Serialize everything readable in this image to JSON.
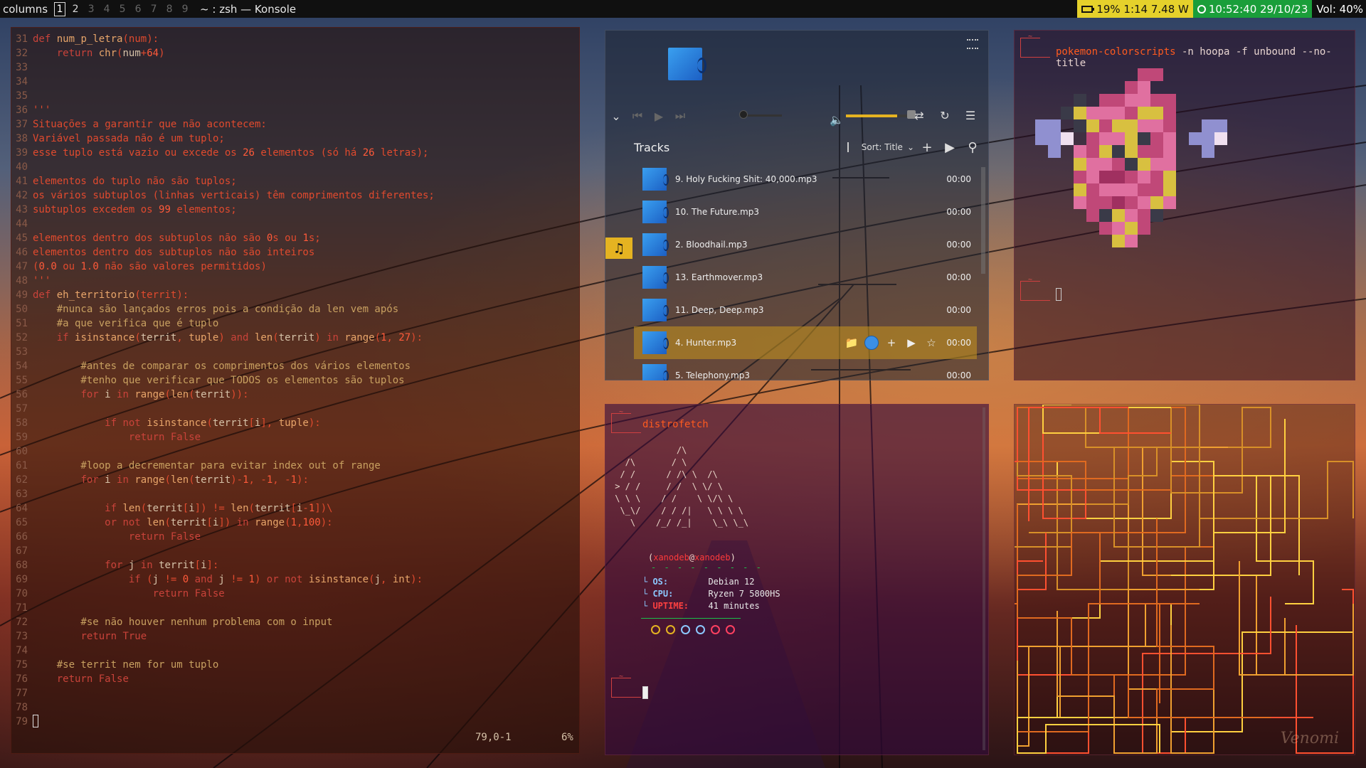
{
  "topbar": {
    "layout": "columns",
    "workspaces": [
      "1",
      "2",
      "3",
      "4",
      "5",
      "6",
      "7",
      "8",
      "9"
    ],
    "active_workspace": "1",
    "window_title": "~ : zsh — Konsole",
    "battery": "19% 1:14 7.48 W",
    "clock": "10:52:40 29/10/23",
    "volume": "Vol: 40%"
  },
  "editor": {
    "lines": [
      {
        "n": "31",
        "code": "def num_p_letra(num):"
      },
      {
        "n": "32",
        "code": "    return chr(num+64)"
      },
      {
        "n": "33",
        "code": ""
      },
      {
        "n": "34",
        "code": ""
      },
      {
        "n": "35",
        "code": ""
      },
      {
        "n": "36",
        "code": "'''"
      },
      {
        "n": "37",
        "code": "Situações a garantir que não acontecem:"
      },
      {
        "n": "38",
        "code": "Variável passada não é um tuplo;"
      },
      {
        "n": "39",
        "code": "esse tuplo está vazio ou excede os 26 elementos (só há 26 letras);"
      },
      {
        "n": "40",
        "code": ""
      },
      {
        "n": "41",
        "code": "elementos do tuplo não são tuplos;"
      },
      {
        "n": "42",
        "code": "os vários subtuplos (linhas verticais) têm comprimentos diferentes;"
      },
      {
        "n": "43",
        "code": "subtuplos excedem os 99 elementos;"
      },
      {
        "n": "44",
        "code": ""
      },
      {
        "n": "45",
        "code": "elementos dentro dos subtuplos não são 0s ou 1s;"
      },
      {
        "n": "46",
        "code": "elementos dentro dos subtuplos não são inteiros"
      },
      {
        "n": "47",
        "code": "(0.0 ou 1.0 não são valores permitidos)"
      },
      {
        "n": "48",
        "code": "'''"
      },
      {
        "n": "49",
        "code": "def eh_territorio(territ):"
      },
      {
        "n": "50",
        "code": "    #nunca são lançados erros pois a condição da len vem após"
      },
      {
        "n": "51",
        "code": "    #a que verifica que é tuplo"
      },
      {
        "n": "52",
        "code": "    if isinstance(territ, tuple) and len(territ) in range(1, 27):"
      },
      {
        "n": "53",
        "code": ""
      },
      {
        "n": "54",
        "code": "        #antes de comparar os comprimentos dos vários elementos"
      },
      {
        "n": "55",
        "code": "        #tenho que verificar que TODOS os elementos são tuplos"
      },
      {
        "n": "56",
        "code": "        for i in range(len(territ)):"
      },
      {
        "n": "57",
        "code": ""
      },
      {
        "n": "58",
        "code": "            if not isinstance(territ[i], tuple):"
      },
      {
        "n": "59",
        "code": "                return False"
      },
      {
        "n": "60",
        "code": ""
      },
      {
        "n": "61",
        "code": "        #loop a decrementar para evitar index out of range"
      },
      {
        "n": "62",
        "code": "        for i in range(len(territ)-1, -1, -1):"
      },
      {
        "n": "63",
        "code": ""
      },
      {
        "n": "64",
        "code": "            if len(territ[i]) != len(territ[i-1])\\"
      },
      {
        "n": "65",
        "code": "            or not len(territ[i]) in range(1,100):"
      },
      {
        "n": "66",
        "code": "                return False"
      },
      {
        "n": "67",
        "code": ""
      },
      {
        "n": "68",
        "code": "            for j in territ[i]:"
      },
      {
        "n": "69",
        "code": "                if (j != 0 and j != 1) or not isinstance(j, int):"
      },
      {
        "n": "70",
        "code": "                    return False"
      },
      {
        "n": "71",
        "code": ""
      },
      {
        "n": "72",
        "code": "        #se não houver nenhum problema com o input"
      },
      {
        "n": "73",
        "code": "        return True"
      },
      {
        "n": "74",
        "code": ""
      },
      {
        "n": "75",
        "code": "    #se territ nem for um tuplo"
      },
      {
        "n": "76",
        "code": "    return False"
      },
      {
        "n": "77",
        "code": ""
      },
      {
        "n": "78",
        "code": ""
      },
      {
        "n": "79",
        "code": ""
      }
    ],
    "status_position": "79,0-1",
    "status_percent": "6%"
  },
  "player": {
    "tracks_title": "Tracks",
    "sort_label": "Sort: Title",
    "tracks": [
      {
        "name": "9. Holy Fucking Shit: 40,000.mp3",
        "time": "00:00",
        "active": false
      },
      {
        "name": "10. The Future.mp3",
        "time": "00:00",
        "active": false
      },
      {
        "name": "2. Bloodhail.mp3",
        "time": "00:00",
        "active": false
      },
      {
        "name": "13. Earthmover.mp3",
        "time": "00:00",
        "active": false
      },
      {
        "name": "11. Deep, Deep.mp3",
        "time": "00:00",
        "active": false
      },
      {
        "name": "4. Hunter.mp3",
        "time": "00:00",
        "active": true
      },
      {
        "name": "5. Telephony.mp3",
        "time": "00:00",
        "active": false
      }
    ],
    "volume_fraction": 0.8,
    "accent": "#e5b321"
  },
  "term_top_right": {
    "prompt": "~",
    "command": "pokemon-colorscripts",
    "args": " -n hoopa -f unbound --no-title"
  },
  "term_bottom_mid": {
    "prompt": "~",
    "command": "distrofetch",
    "art": "             /\\\n   /\\       / \\              \n  / /      / /\\ \\  /\\         \n > / /     / /  \\ \\/ \\        \n \\ \\ \\    / /    \\ \\/\\ \\       \n  \\_\\/    / / /|   \\ \\ \\ \\      \n    \\    /_/ /_|    \\_\\ \\_\\     ",
    "user": "xanodeb",
    "host": "xanodeb",
    "dashes": "- - - - - - - - -",
    "info": [
      {
        "key": "OS:",
        "value": "Debian 12"
      },
      {
        "key": "CPU:",
        "value": "Ryzen 7 5800HS"
      },
      {
        "key": "UPTIME:",
        "value": "41 minutes"
      }
    ],
    "dot_colors": [
      "#e5b321",
      "#e5b321",
      "#8cc8ff",
      "#8cc8ff",
      "#ff4060",
      "#ff4060"
    ]
  },
  "term_bottom_right": {
    "signature": "Venomi"
  }
}
